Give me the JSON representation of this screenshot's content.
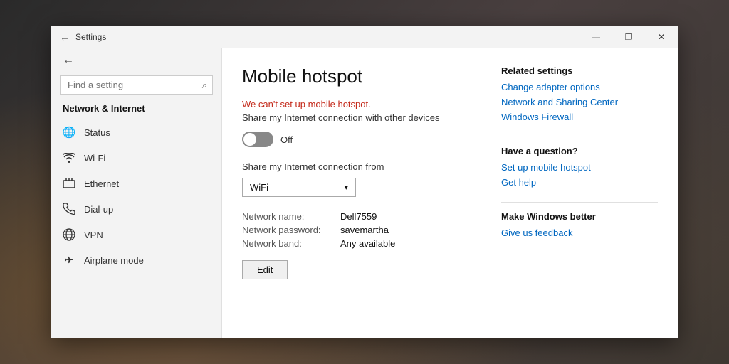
{
  "titlebar": {
    "title": "Settings",
    "minimize": "—",
    "maximize": "❐",
    "close": "✕"
  },
  "sidebar": {
    "back_icon": "←",
    "search_placeholder": "Find a setting",
    "search_icon": "⌕",
    "section_title": "Network & Internet",
    "items": [
      {
        "id": "status",
        "label": "Status",
        "icon": "🌐"
      },
      {
        "id": "wifi",
        "label": "Wi-Fi",
        "icon": "📶"
      },
      {
        "id": "ethernet",
        "label": "Ethernet",
        "icon": "🖥"
      },
      {
        "id": "dialup",
        "label": "Dial-up",
        "icon": "📞"
      },
      {
        "id": "vpn",
        "label": "VPN",
        "icon": "🔒"
      },
      {
        "id": "airplane",
        "label": "Airplane mode",
        "icon": "✈"
      }
    ]
  },
  "main": {
    "page_title": "Mobile hotspot",
    "error_text": "We can't set up mobile hotspot.",
    "share_desc": "Share my Internet connection with other devices",
    "toggle_state": "Off",
    "share_from_label": "Share my Internet connection from",
    "dropdown_value": "WiFi",
    "network_name_label": "Network name:",
    "network_name_value": "Dell7559",
    "network_password_label": "Network password:",
    "network_password_value": "savemartha",
    "network_band_label": "Network band:",
    "network_band_value": "Any available",
    "edit_button": "Edit"
  },
  "right_panel": {
    "related_title": "Related settings",
    "links": [
      "Change adapter options",
      "Network and Sharing Center",
      "Windows Firewall"
    ],
    "question_title": "Have a question?",
    "question_links": [
      "Set up mobile hotspot",
      "Get help"
    ],
    "better_title": "Make Windows better",
    "better_links": [
      "Give us feedback"
    ]
  }
}
